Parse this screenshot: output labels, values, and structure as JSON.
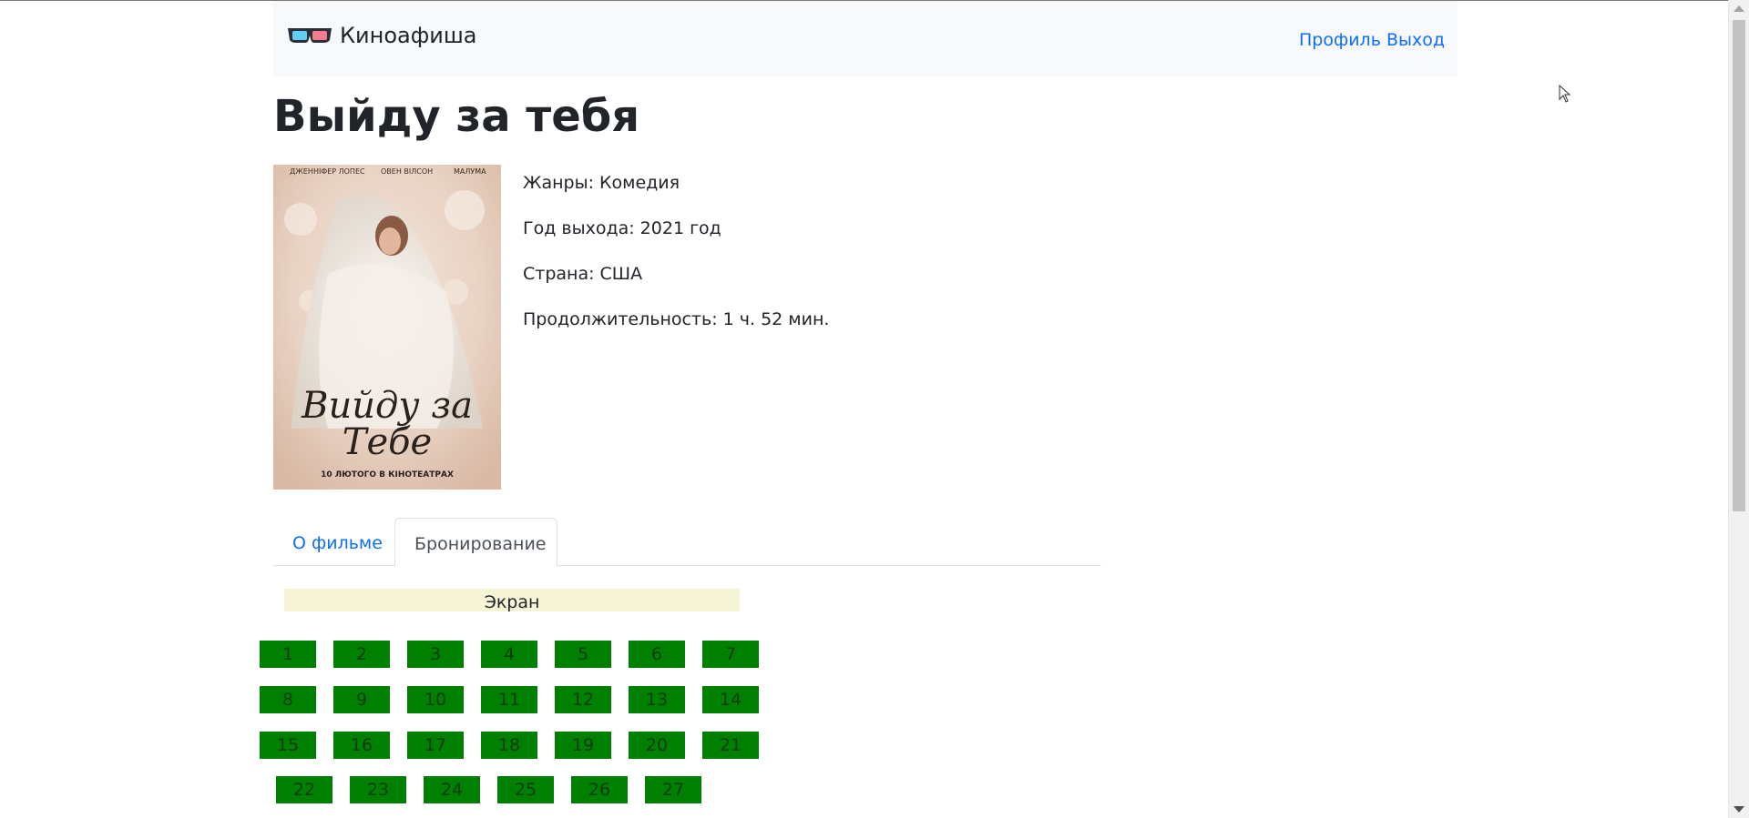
{
  "nav": {
    "brand": "Киноафиша",
    "profile": "Профиль",
    "logout": "Выход"
  },
  "movie": {
    "title": "Выйду за тебя",
    "genres": "Жанры: Комедия",
    "year": "Год выхода: 2021 год",
    "country": "Страна: США",
    "duration": "Продолжительность: 1 ч. 52 мин."
  },
  "poster": {
    "actors": [
      "ДЖЕННІФЕР ЛОПЕС",
      "ОВЕН ВІЛСОН",
      "МАЛУМА"
    ],
    "title_line1": "Вийду за",
    "title_line2": "Тебе",
    "release": "10 ЛЮТОГО В КІНОТЕАТРАХ"
  },
  "tabs": {
    "about": "О фильме",
    "booking": "Бронирование"
  },
  "hall": {
    "screen": "Экран",
    "seat_color": "#008000",
    "rows": [
      [
        "1",
        "2",
        "3",
        "4",
        "5",
        "6",
        "7"
      ],
      [
        "8",
        "9",
        "10",
        "11",
        "12",
        "13",
        "14"
      ],
      [
        "15",
        "16",
        "17",
        "18",
        "19",
        "20",
        "21"
      ],
      [
        "22",
        "23",
        "24",
        "25",
        "26",
        "27"
      ]
    ]
  },
  "colors": {
    "link": "#0d6efd",
    "navbar_bg": "#f8f9fa",
    "screen_bg": "#f5f5d5"
  }
}
